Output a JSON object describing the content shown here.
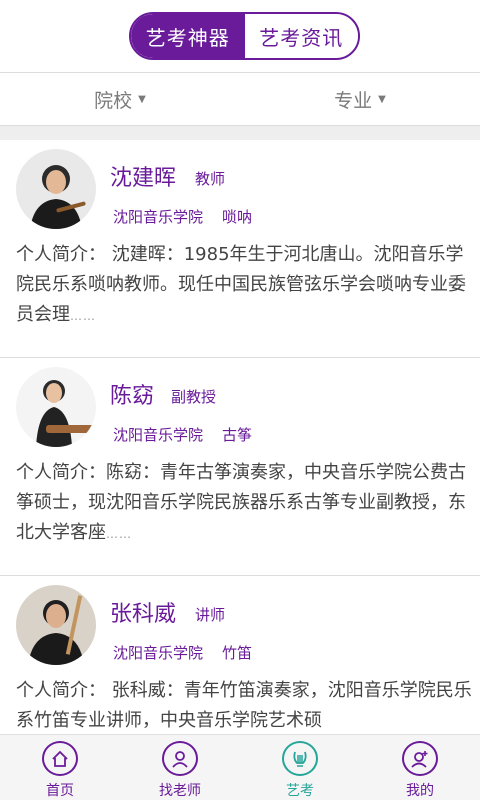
{
  "header": {
    "tabs": [
      {
        "label": "艺考神器",
        "active": true
      },
      {
        "label": "艺考资讯",
        "active": false
      }
    ]
  },
  "filters": [
    {
      "label": "院校"
    },
    {
      "label": "专业"
    }
  ],
  "teachers": [
    {
      "name": "沈建晖",
      "title": "教师",
      "school": "沈阳音乐学院",
      "major": "唢呐",
      "intro": "个人简介： 沈建晖：1985年生于河北唐山。沈阳音乐学院民乐系唢呐教师。现任中国民族管弦乐学会唢呐专业委员会理",
      "ellipsis": "……"
    },
    {
      "name": "陈窈",
      "title": "副教授",
      "school": "沈阳音乐学院",
      "major": "古筝",
      "intro": "个人简介：陈窈：青年古筝演奏家，中央音乐学院公费古筝硕士，现沈阳音乐学院民族器乐系古筝专业副教授，东北大学客座",
      "ellipsis": "……"
    },
    {
      "name": "张科威",
      "title": "讲师",
      "school": "沈阳音乐学院",
      "major": "竹笛",
      "intro": "个人简介： 张科威：青年竹笛演奏家，沈阳音乐学院民乐系竹笛专业讲师，中央音乐学院艺术硕",
      "ellipsis": ""
    }
  ],
  "nav": [
    {
      "label": "首页",
      "icon": "home-icon",
      "active": false
    },
    {
      "label": "找老师",
      "icon": "teacher-icon",
      "active": false
    },
    {
      "label": "艺考",
      "icon": "lyre-icon",
      "active": true
    },
    {
      "label": "我的",
      "icon": "user-add-icon",
      "active": false
    }
  ],
  "colors": {
    "accent": "#6a1b9a",
    "active_nav": "#26a69a",
    "text": "#444444",
    "muted": "#7a7a7a"
  }
}
